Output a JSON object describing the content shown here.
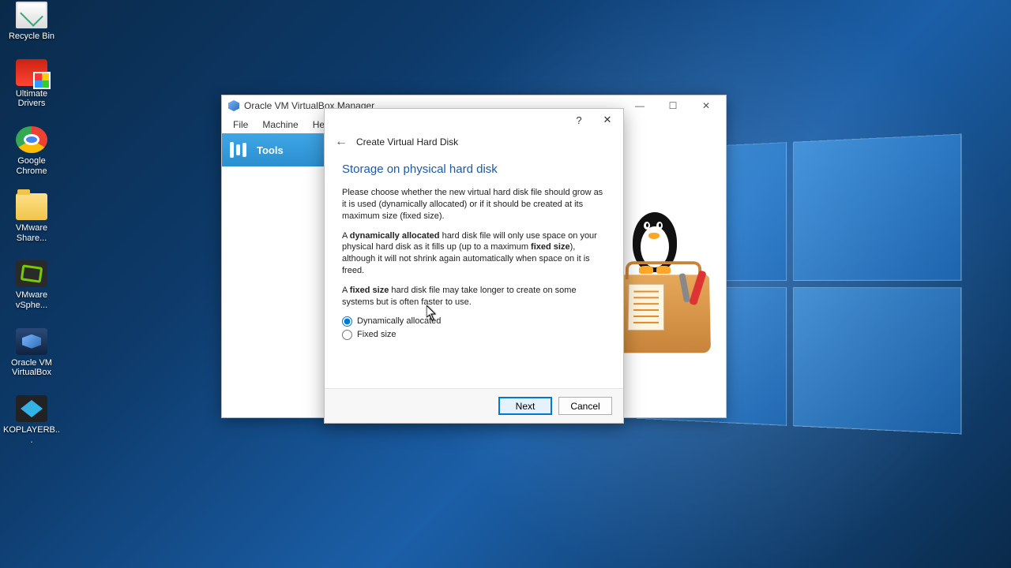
{
  "desktop": {
    "icons": [
      {
        "label": "Recycle Bin",
        "icon": "recycle-bin-icon"
      },
      {
        "label": "Ultimate Drivers",
        "icon": "drivers-icon"
      },
      {
        "label": "Google Chrome",
        "icon": "chrome-icon"
      },
      {
        "label": "VMware Share...",
        "icon": "folder-icon"
      },
      {
        "label": "VMware vSphe...",
        "icon": "vsphere-icon"
      },
      {
        "label": "Oracle VM VirtualBox",
        "icon": "virtualbox-icon"
      },
      {
        "label": "KOPLAYERB...",
        "icon": "koplayer-icon"
      }
    ]
  },
  "vb_manager": {
    "title": "Oracle VM VirtualBox Manager",
    "menu": {
      "file": "File",
      "machine": "Machine",
      "help": "Help"
    },
    "sidebar": {
      "tools": "Tools"
    }
  },
  "wizard": {
    "header": "Create Virtual Hard Disk",
    "title": "Storage on physical hard disk",
    "p1": "Please choose whether the new virtual hard disk file should grow as it is used (dynamically allocated) or if it should be created at its maximum size (fixed size).",
    "p2a": "A ",
    "p2b": "dynamically allocated",
    "p2c": " hard disk file will only use space on your physical hard disk as it fills up (up to a maximum ",
    "p2d": "fixed size",
    "p2e": "), although it will not shrink again automatically when space on it is freed.",
    "p3a": "A ",
    "p3b": "fixed size",
    "p3c": " hard disk file may take longer to create on some systems but is often faster to use.",
    "opt_dynamic": "Dynamically allocated",
    "opt_fixed": "Fixed size",
    "selected": "dynamic",
    "next": "Next",
    "cancel": "Cancel",
    "help": "?",
    "close": "✕"
  },
  "win_controls": {
    "min": "—",
    "max": "☐",
    "close": "✕"
  }
}
